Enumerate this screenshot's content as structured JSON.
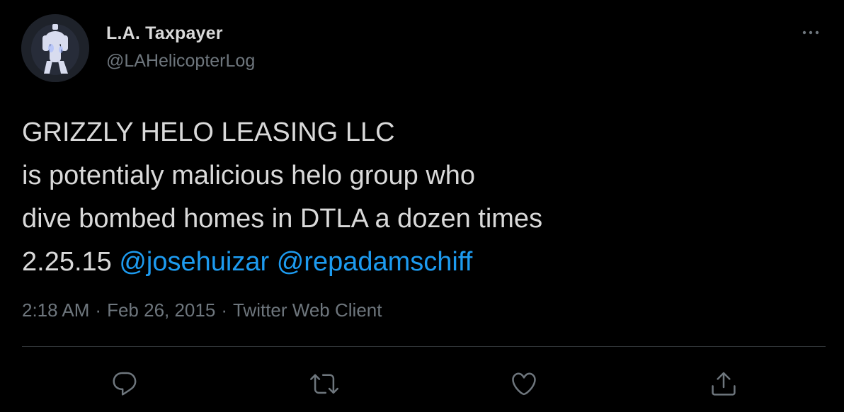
{
  "user": {
    "display_name": "L.A. Taxpayer",
    "handle": "@LAHelicopterLog",
    "avatar_icon": "helicopter-dog-avatar"
  },
  "tweet": {
    "lines": [
      "GRIZZLY HELO LEASING LLC",
      "is potentialy malicious helo group who",
      "dive bombed homes in DTLA a dozen times"
    ],
    "last_line_prefix": "2.25.15",
    "mentions": [
      "@josehuizar",
      "@repadamschiff"
    ]
  },
  "meta": {
    "time": "2:18 AM",
    "separator": "·",
    "date": "Feb 26, 2015",
    "client": "Twitter Web Client"
  },
  "actions": {
    "reply_icon": "reply-icon",
    "retweet_icon": "retweet-icon",
    "like_icon": "heart-icon",
    "share_icon": "share-icon",
    "more_icon": "more-icon"
  },
  "colors": {
    "background": "#000000",
    "text": "#d9d9d9",
    "secondary_text": "#6e767d",
    "mention": "#1d9bf0",
    "divider": "#2f3336"
  }
}
